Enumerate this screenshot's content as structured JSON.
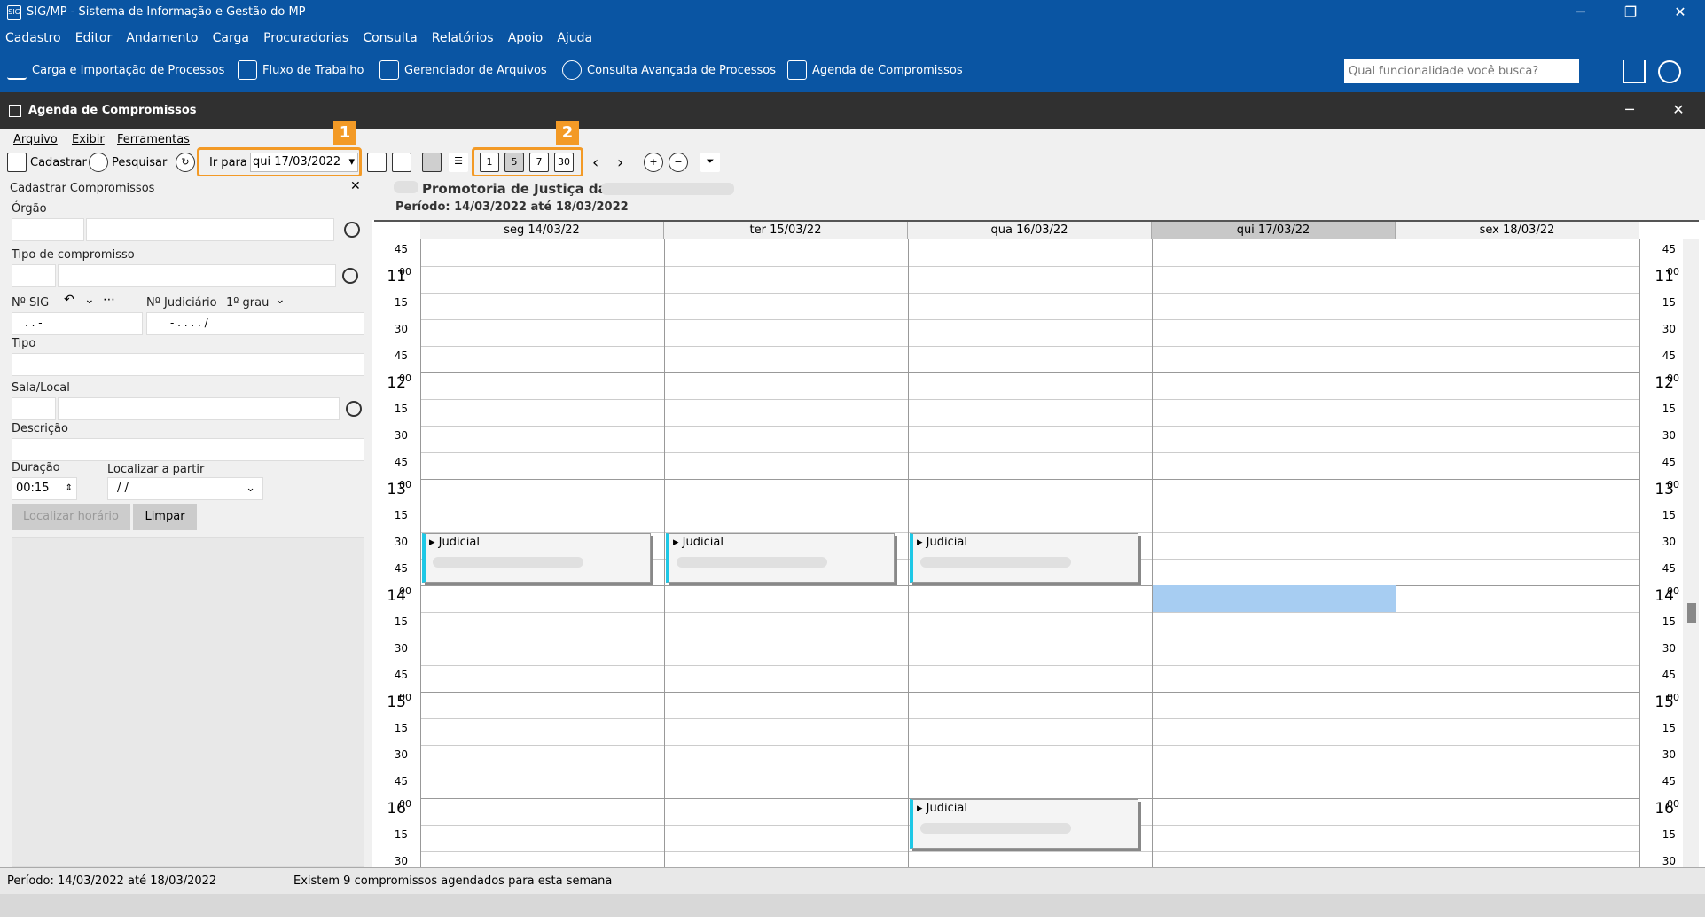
{
  "window": {
    "title": "SIG/MP - Sistema de Informação e Gestão do MP",
    "minimize": "─",
    "restore": "❐",
    "close": "✕"
  },
  "menu": [
    "Cadastro",
    "Editor",
    "Andamento",
    "Carga",
    "Procuradorias",
    "Consulta",
    "Relatórios",
    "Apoio",
    "Ajuda"
  ],
  "quickbar": {
    "items": [
      "Carga e Importação de Processos",
      "Fluxo de Trabalho",
      "Gerenciador de Arquivos",
      "Consulta Avançada de Processos",
      "Agenda de Compromissos"
    ],
    "search_placeholder": "Qual funcionalidade você busca?"
  },
  "subwindow": {
    "title": "Agenda de Compromissos"
  },
  "submenu": [
    "Arquivo",
    "Exibir",
    "Ferramentas"
  ],
  "toolbar": {
    "cadastrar": "Cadastrar",
    "pesquisar": "Pesquisar",
    "ir_para": "Ir para",
    "date_value": "qui 17/03/2022",
    "badge1": "1",
    "badge2": "2",
    "view1": "1",
    "view5": "5",
    "view7": "7",
    "view30": "30"
  },
  "panel": {
    "title": "Cadastrar Compromissos",
    "orgao": "Órgão",
    "tipo_compromisso": "Tipo de compromisso",
    "nsig": "Nº SIG",
    "njudiciario": "Nº Judiciário",
    "grau": "1º grau",
    "nsig_mask": ". .   -",
    "njud_mask": "- . . . . /",
    "tipo": "Tipo",
    "sala": "Sala/Local",
    "descricao": "Descrição",
    "duracao": "Duração",
    "duracao_value": "00:15",
    "localizar_partir": "Localizar a partir",
    "localizar_value": "/ /",
    "btn_localizar": "Localizar horário",
    "btn_limpar": "Limpar"
  },
  "calendar": {
    "org_name": "Promotoria de Justiça da",
    "periodo": "Período: 14/03/2022 até 18/03/2022",
    "days": [
      "seg 14/03/22",
      "ter 15/03/22",
      "qua 16/03/22",
      "qui 17/03/22",
      "sex 18/03/22"
    ],
    "hours": [
      "11",
      "12",
      "13",
      "14",
      "15",
      "16"
    ],
    "appointment_label": "Judicial"
  },
  "status": {
    "periodo": "Período: 14/03/2022 até 18/03/2022",
    "info": "Existem 9 compromissos agendados para esta semana"
  }
}
